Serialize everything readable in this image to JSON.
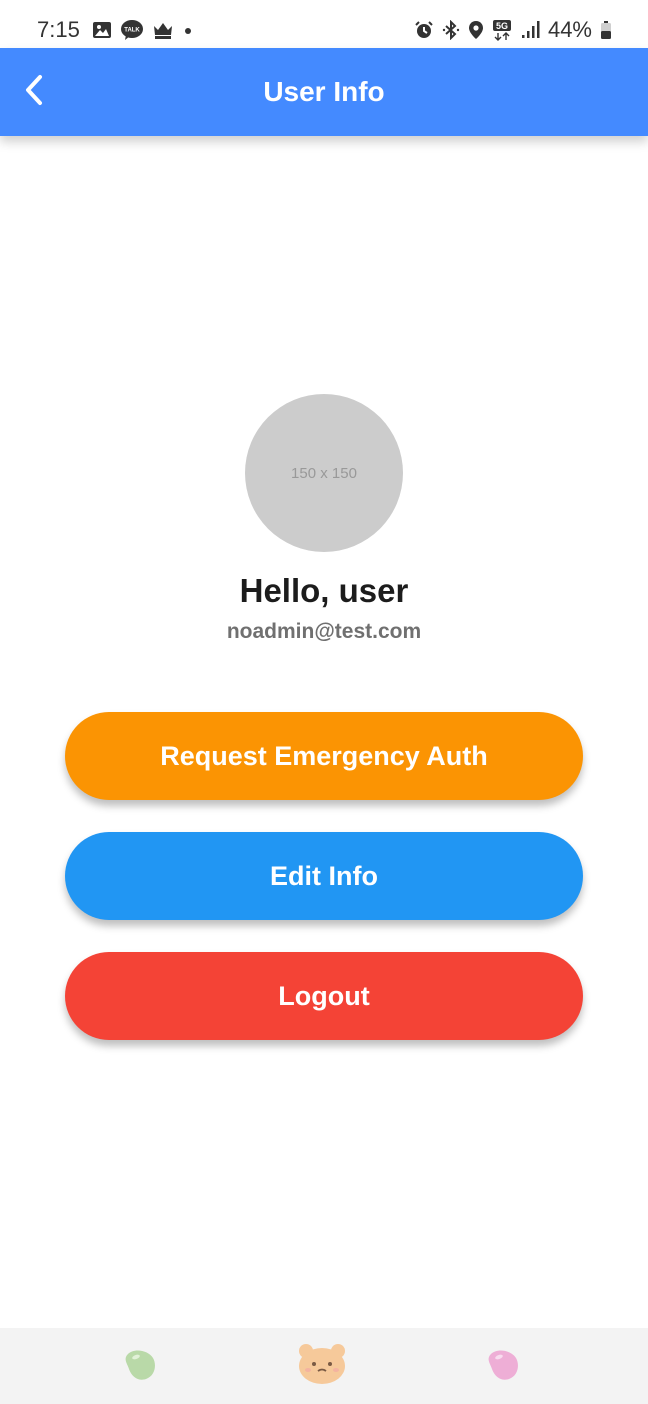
{
  "status_bar": {
    "time": "7:15",
    "battery": "44%",
    "left_icons": [
      "image-icon",
      "talk-icon",
      "crown-icon",
      "dot-icon"
    ],
    "right_icons": [
      "alarm-icon",
      "bluetooth-icon",
      "location-icon",
      "5g-icon",
      "signal-icon",
      "battery-icon"
    ],
    "network_label": "5G",
    "talk_label": "TALK"
  },
  "app_bar": {
    "title": "User Info",
    "back_icon": "chevron-left-icon",
    "color": "#448aff"
  },
  "profile": {
    "avatar_placeholder": "150 x 150",
    "greeting": "Hello, user",
    "email": "noadmin@test.com"
  },
  "actions": {
    "emergency_label": "Request Emergency Auth",
    "emergency_color": "#fb9403",
    "edit_label": "Edit Info",
    "edit_color": "#2196f3",
    "logout_label": "Logout",
    "logout_color": "#f44336"
  },
  "bottom_nav": {
    "items": [
      {
        "icon": "green-bean-icon",
        "color": "#b9d9a8"
      },
      {
        "icon": "bear-face-icon",
        "color": "#f6c99a"
      },
      {
        "icon": "pink-bean-icon",
        "color": "#eeaed6"
      }
    ]
  }
}
